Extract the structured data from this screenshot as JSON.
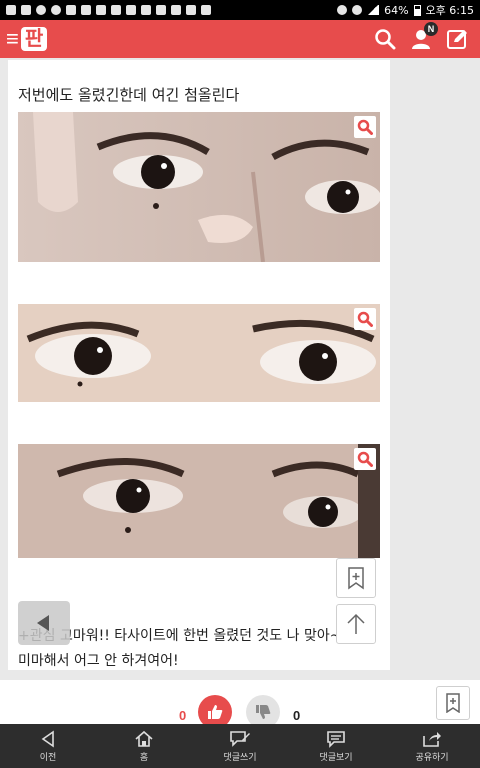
{
  "status_bar": {
    "battery": "64%",
    "time": "오후 6:15"
  },
  "header": {
    "logo_text": "≡",
    "logo_box": "판",
    "notification_badge": "N"
  },
  "post": {
    "title": "저번에도 올렸긴한데 여긴 첨올린다",
    "body_line1": "+관심 고마워!! 타사이트에 한번 올렸던 것도 나 맞아~",
    "body_line2": "미마해서 어그 안 하겨여어!"
  },
  "votes": {
    "up_count": "0",
    "down_count": "0"
  },
  "bottom_nav": {
    "items": [
      {
        "label": "이전",
        "icon": "back-arrow-icon"
      },
      {
        "label": "홈",
        "icon": "home-icon"
      },
      {
        "label": "댓글쓰기",
        "icon": "write-comment-icon"
      },
      {
        "label": "댓글보기",
        "icon": "view-comments-icon"
      },
      {
        "label": "공유하기",
        "icon": "share-icon"
      }
    ]
  },
  "colors": {
    "brand": "#e74c4c",
    "nav_bg": "#2d2d2d"
  }
}
